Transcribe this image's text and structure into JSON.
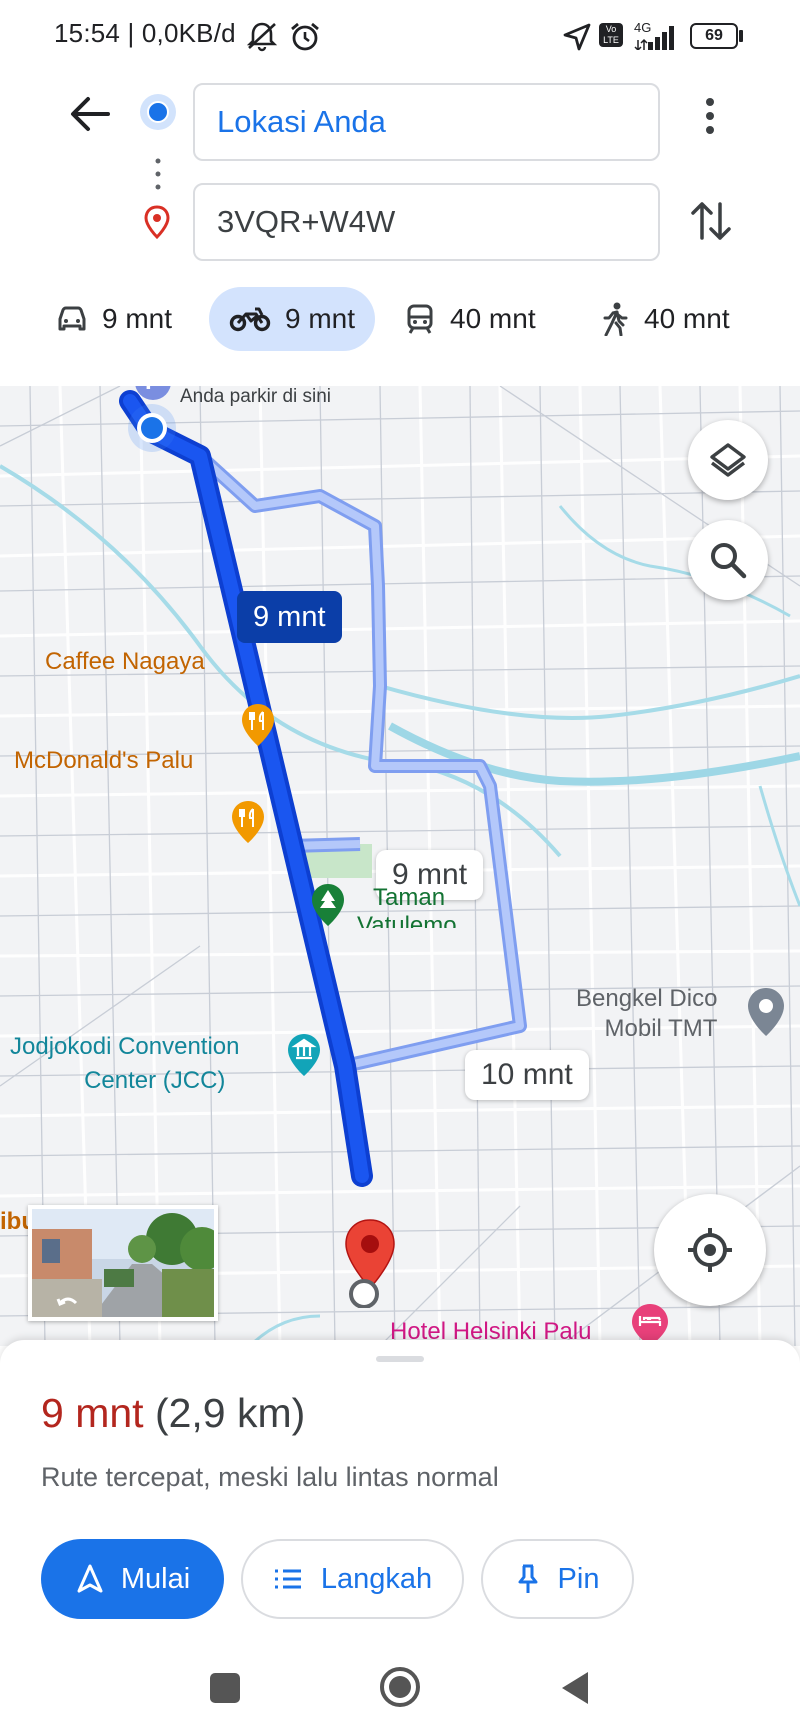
{
  "status_bar": {
    "time_speed": "15:54 | 0,0KB/d",
    "network": "4G",
    "volte": "Vo LTE",
    "battery": "69"
  },
  "route": {
    "origin": "Lokasi Anda",
    "destination": "3VQR+W4W"
  },
  "modes": [
    {
      "icon": "car-icon",
      "label": "9 mnt",
      "selected": false
    },
    {
      "icon": "motorcycle-icon",
      "label": "9 mnt",
      "selected": true
    },
    {
      "icon": "transit-icon",
      "label": "40 mnt",
      "selected": false
    },
    {
      "icon": "walk-icon",
      "label": "40 mnt",
      "selected": false
    }
  ],
  "map": {
    "parking_label": "Anda parkir di sini",
    "parking_letter": "P",
    "route_badge_main": "9 mnt",
    "route_badge_alt1": "9 mnt",
    "route_badge_alt2": "10 mnt",
    "places": {
      "caffee": "Caffee Nagaya",
      "mcdonalds": "McDonald's Palu",
      "taman_line1": "Taman",
      "taman_line2": "Vatulemo",
      "bengkel_line1": "Bengkel Dico",
      "bengkel_line2": "Mobil TMT",
      "jcc_line1": "Jodjokodi Convention",
      "jcc_line2": "Center (JCC)",
      "hotel": "Hotel Helsinki Palu",
      "left_edge": "ibu"
    },
    "colors": {
      "route_primary": "#1a56f0",
      "route_alt": "#a8bff7",
      "food": "#f29900",
      "park": "#188038",
      "hotel": "#e8407a",
      "destination_pin": "#ea4335"
    }
  },
  "summary": {
    "duration": "9 mnt",
    "distance": "(2,9 km)",
    "description": "Rute tercepat, meski lalu lintas normal"
  },
  "buttons": {
    "start": "Mulai",
    "steps": "Langkah",
    "pin": "Pin"
  }
}
